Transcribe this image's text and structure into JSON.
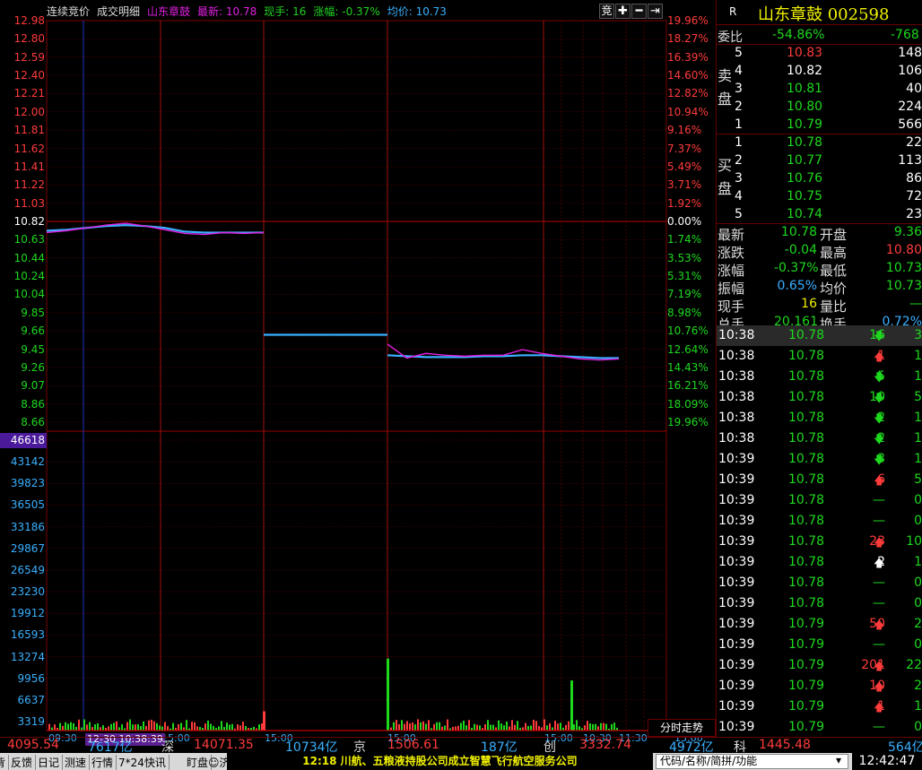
{
  "title_bar": {
    "tab_auction": "连续竞价",
    "tab_detail": "成交明细",
    "stock_name": "山东章鼓",
    "latest_label": "最新: 10.78",
    "now_hand": "现手: 16",
    "change": "涨幅: -0.37%",
    "avg": "均价: 10.73",
    "btn_bid": "竞",
    "btn_plus": "✚",
    "btn_minus": "━",
    "btn_next": "⇥"
  },
  "price_axis_left": [
    "12.98",
    "12.80",
    "12.59",
    "12.40",
    "12.21",
    "12.00",
    "11.81",
    "11.62",
    "11.41",
    "11.22",
    "11.03",
    "10.82",
    "10.63",
    "10.44",
    "10.24",
    "10.04",
    "9.85",
    "9.66",
    "9.45",
    "9.26",
    "9.07",
    "8.86",
    "8.66"
  ],
  "price_axis_right": [
    "19.96%",
    "18.27%",
    "16.39%",
    "14.60%",
    "12.82%",
    "10.94%",
    "9.16%",
    "7.37%",
    "5.49%",
    "3.71%",
    "1.92%",
    "0.00%",
    "1.74%",
    "3.53%",
    "5.31%",
    "7.19%",
    "8.98%",
    "10.76%",
    "12.64%",
    "14.43%",
    "16.21%",
    "18.09%",
    "19.96%"
  ],
  "volume_axis": [
    "46618",
    "43142",
    "39823",
    "36505",
    "33186",
    "29867",
    "26549",
    "23230",
    "19912",
    "16593",
    "13274",
    "9956",
    "6637",
    "3319"
  ],
  "time_axis": [
    "09:30",
    "15:00",
    "15:00",
    "15:00",
    "15:00",
    "10:30",
    "11:30",
    "15:00"
  ],
  "cursor_stamp": "12-30 10:38:39",
  "chart_tag": "分时走势",
  "chart_data": {
    "type": "line",
    "prev_close": 10.82,
    "y_range": [
      8.66,
      12.98
    ],
    "segments": [
      {
        "name": "day1",
        "price": [
          10.7,
          10.72,
          10.75,
          10.78,
          10.8,
          10.77,
          10.73,
          10.69,
          10.68,
          10.7,
          10.69,
          10.7
        ],
        "avg": [
          10.72,
          10.73,
          10.75,
          10.77,
          10.78,
          10.77,
          10.75,
          10.71,
          10.7,
          10.7,
          10.7,
          10.7
        ]
      },
      {
        "name": "day2",
        "price": [
          9.6,
          9.6
        ],
        "avg": [
          9.6,
          9.6
        ]
      },
      {
        "name": "day3",
        "price": [
          9.5,
          9.35,
          9.4,
          9.38,
          9.37,
          9.38,
          9.38,
          9.44,
          9.4,
          9.37,
          9.34,
          9.33,
          9.34
        ],
        "avg": [
          9.38,
          9.37,
          9.36,
          9.36,
          9.36,
          9.37,
          9.37,
          9.38,
          9.38,
          9.37,
          9.36,
          9.35,
          9.35
        ]
      }
    ],
    "volume_max": 46618,
    "volume_peaks": [
      {
        "day": "day1",
        "value": 3000
      },
      {
        "day": "day3",
        "value": 11200
      },
      {
        "day": "day3",
        "value": 7800
      }
    ]
  },
  "quote_header": {
    "R": "R",
    "name": "山东章鼓 002598"
  },
  "weibi": {
    "label": "委比",
    "pct": "-54.86%",
    "val": "-768"
  },
  "sell_label": "卖盘",
  "buy_label": "买盘",
  "asks": [
    {
      "lv": "5",
      "price": "10.83",
      "vol": "148"
    },
    {
      "lv": "4",
      "price": "10.82",
      "vol": "106"
    },
    {
      "lv": "3",
      "price": "10.81",
      "vol": "40"
    },
    {
      "lv": "2",
      "price": "10.80",
      "vol": "224"
    },
    {
      "lv": "1",
      "price": "10.79",
      "vol": "566"
    }
  ],
  "bids": [
    {
      "lv": "1",
      "price": "10.78",
      "vol": "22"
    },
    {
      "lv": "2",
      "price": "10.77",
      "vol": "113"
    },
    {
      "lv": "3",
      "price": "10.76",
      "vol": "86"
    },
    {
      "lv": "4",
      "price": "10.75",
      "vol": "72"
    },
    {
      "lv": "5",
      "price": "10.74",
      "vol": "23"
    }
  ],
  "stats": [
    {
      "k1": "最新",
      "v1": "10.78",
      "k2": "开盘",
      "v2": "9.36"
    },
    {
      "k1": "涨跌",
      "v1": "-0.04",
      "k2": "最高",
      "v2": "10.80"
    },
    {
      "k1": "涨幅",
      "v1": "-0.37%",
      "k2": "最低",
      "v2": "10.73"
    },
    {
      "k1": "振幅",
      "v1": "0.65%",
      "k2": "均价",
      "v2": "10.73"
    },
    {
      "k1": "现手",
      "v1": "16",
      "k2": "量比",
      "v2": "—"
    },
    {
      "k1": "总手",
      "v1": "20,161",
      "k2": "换手",
      "v2": "0.72%"
    }
  ],
  "ticks": [
    {
      "t": "10:38",
      "p": "10.78",
      "v": "16",
      "d": "down",
      "n": "3"
    },
    {
      "t": "10:38",
      "p": "10.78",
      "v": "1",
      "d": "up",
      "n": "1"
    },
    {
      "t": "10:38",
      "p": "10.78",
      "v": "5",
      "d": "down",
      "n": "1"
    },
    {
      "t": "10:38",
      "p": "10.78",
      "v": "10",
      "d": "down",
      "n": "5"
    },
    {
      "t": "10:38",
      "p": "10.78",
      "v": "2",
      "d": "down",
      "n": "1"
    },
    {
      "t": "10:38",
      "p": "10.78",
      "v": "2",
      "d": "down",
      "n": "1"
    },
    {
      "t": "10:39",
      "p": "10.78",
      "v": "3",
      "d": "down",
      "n": "1"
    },
    {
      "t": "10:39",
      "p": "10.78",
      "v": "6",
      "d": "up",
      "n": "5"
    },
    {
      "t": "10:39",
      "p": "10.78",
      "v": "",
      "d": "flat",
      "n": "0"
    },
    {
      "t": "10:39",
      "p": "10.78",
      "v": "",
      "d": "flat",
      "n": "0"
    },
    {
      "t": "10:39",
      "p": "10.78",
      "v": "23",
      "d": "up",
      "n": "10"
    },
    {
      "t": "10:39",
      "p": "10.78",
      "v": "2",
      "d": "upw",
      "n": "1"
    },
    {
      "t": "10:39",
      "p": "10.78",
      "v": "",
      "d": "flat",
      "n": "0"
    },
    {
      "t": "10:39",
      "p": "10.78",
      "v": "",
      "d": "flat",
      "n": "0"
    },
    {
      "t": "10:39",
      "p": "10.79",
      "v": "50",
      "d": "up",
      "n": "2"
    },
    {
      "t": "10:39",
      "p": "10.79",
      "v": "",
      "d": "flat",
      "n": "0"
    },
    {
      "t": "10:39",
      "p": "10.79",
      "v": "201",
      "d": "up",
      "n": "22"
    },
    {
      "t": "10:39",
      "p": "10.79",
      "v": "10",
      "d": "up",
      "n": "2"
    },
    {
      "t": "10:39",
      "p": "10.79",
      "v": "1",
      "d": "up",
      "n": "1"
    },
    {
      "t": "10:39",
      "p": "10.79",
      "v": "",
      "d": "flat",
      "n": "0"
    }
  ],
  "indices": [
    {
      "name": "",
      "val": "4095.54",
      "amt": "7617亿"
    },
    {
      "name": "深",
      "val": "14071.35",
      "amt": "10734亿"
    },
    {
      "name": "京",
      "val": "1506.61",
      "amt": "187亿"
    },
    {
      "name": "创",
      "val": "3332.74",
      "amt": "4972亿"
    },
    {
      "name": "科",
      "val": "1445.48",
      "amt": "564亿"
    }
  ],
  "status_bar": {
    "tabs": [
      "背",
      "反馈",
      "日记",
      "测速",
      "行情",
      "7*24快讯",
      "盯盘"
    ],
    "ai": "☺济",
    "news": "12:18 川航、五粮液持股公司成立智慧飞行航空服务公司",
    "code_placeholder": "代码/名称/简拼/功能",
    "clock": "12:42:47"
  },
  "colors": {
    "up": "#ff3b3b",
    "down": "#1ed81e",
    "avg_line": "#3ab0ff",
    "price_line": "#e020e0",
    "grid": "#7a0000"
  }
}
